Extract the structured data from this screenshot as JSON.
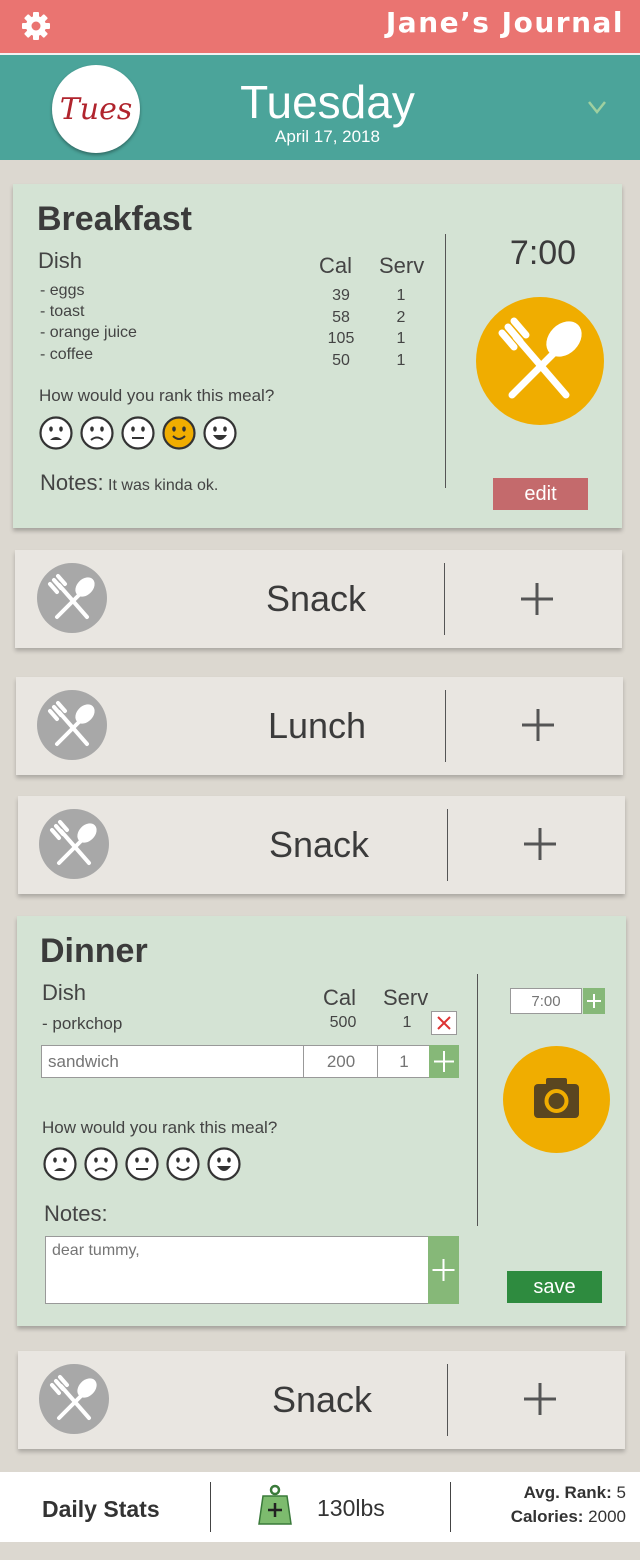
{
  "header": {
    "app_title": "Jane’s Journal",
    "day_badge": "Tues",
    "day_name": "Tuesday",
    "date": "April 17, 2018"
  },
  "breakfast": {
    "title": "Breakfast",
    "dish_header": "Dish",
    "cal_header": "Cal",
    "serv_header": "Serv",
    "items": [
      {
        "name": "- eggs",
        "cal": "39",
        "serv": "1"
      },
      {
        "name": "- toast",
        "cal": "58",
        "serv": "2"
      },
      {
        "name": "- orange juice",
        "cal": "105",
        "serv": "1"
      },
      {
        "name": "- coffee",
        "cal": "50",
        "serv": "1"
      }
    ],
    "rank_question": "How would you rank this meal?",
    "selected_rank": 4,
    "notes_label": "Notes:",
    "notes_text": "It was kinda ok.",
    "time": "7:00",
    "edit_label": "edit"
  },
  "rows": [
    {
      "label": "Snack"
    },
    {
      "label": "Lunch"
    },
    {
      "label": "Snack"
    },
    {
      "label": "Snack"
    }
  ],
  "dinner": {
    "title": "Dinner",
    "dish_header": "Dish",
    "cal_header": "Cal",
    "serv_header": "Serv",
    "item": {
      "name": "- porkchop",
      "cal": "500",
      "serv": "1"
    },
    "new_item": {
      "dish_placeholder": "sandwich",
      "cal_placeholder": "200",
      "serv_placeholder": "1"
    },
    "rank_question": "How would you rank this meal?",
    "notes_label": "Notes:",
    "notes_placeholder": "dear tummy,",
    "time_placeholder": "7:00",
    "save_label": "save"
  },
  "footer": {
    "stats_label": "Daily Stats",
    "weight": "130lbs",
    "avg_rank_label": "Avg. Rank:",
    "avg_rank_value": "5",
    "calories_label": "Calories:",
    "calories_value": "2000"
  },
  "colors": {
    "top_bar": "#ea7471",
    "day_header": "#4ba49a",
    "card_green": "#d4e3d4",
    "accent_yellow": "#f0ad00",
    "edit_button": "#c46a6c",
    "save_button": "#2e8b3f"
  },
  "icons": {
    "settings": "gear-icon",
    "expand": "chevron-down-icon",
    "meal": "fork-spoon-icon",
    "camera": "camera-icon",
    "add": "plus-icon",
    "remove": "close-icon",
    "weight": "weight-icon"
  }
}
